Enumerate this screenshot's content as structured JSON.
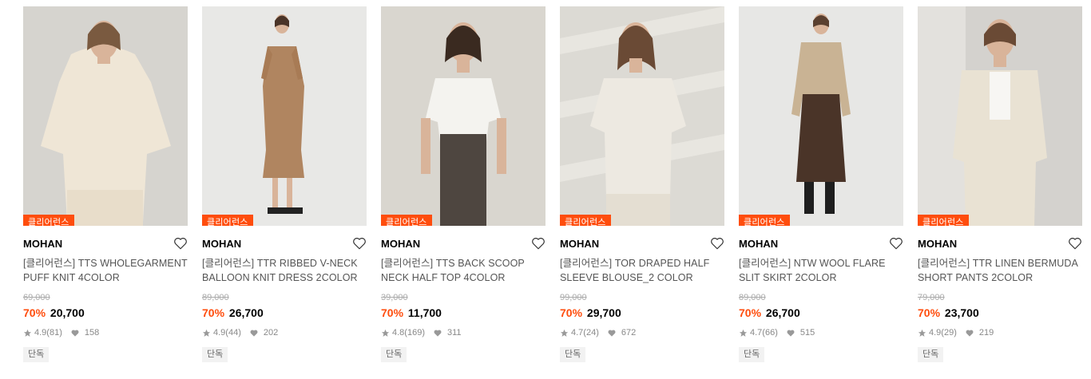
{
  "products": [
    {
      "badge": "클리어런스",
      "brand": "MOHAN",
      "name": "[클리어런스] TTS WHOLEGARMENT PUFF KNIT 4COLOR",
      "original_price": "69,000",
      "discount": "70%",
      "price": "20,700",
      "rating": "4.9",
      "reviews": "(81)",
      "likes": "158",
      "tag": "단독",
      "bg": "#cfcdc8",
      "garment": "#efe6d6"
    },
    {
      "badge": "클리어런스",
      "brand": "MOHAN",
      "name": "[클리어런스] TTR RIBBED V-NECK BALLOON KNIT DRESS 2COLOR",
      "original_price": "89,000",
      "discount": "70%",
      "price": "26,700",
      "rating": "4.9",
      "reviews": "(44)",
      "likes": "202",
      "tag": "단독",
      "bg": "#e8e8e6",
      "garment": "#b08560"
    },
    {
      "badge": "클리어런스",
      "brand": "MOHAN",
      "name": "[클리어런스] TTS BACK SCOOP NECK HALF TOP 4COLOR",
      "original_price": "39,000",
      "discount": "70%",
      "price": "11,700",
      "rating": "4.8",
      "reviews": "(169)",
      "likes": "311",
      "tag": "단독",
      "bg": "#d9d6cf",
      "garment": "#f4f3ef"
    },
    {
      "badge": "클리어런스",
      "brand": "MOHAN",
      "name": "[클리어런스] TOR DRAPED HALF SLEEVE BLOUSE_2 COLOR",
      "original_price": "99,000",
      "discount": "70%",
      "price": "29,700",
      "rating": "4.7",
      "reviews": "(24)",
      "likes": "672",
      "tag": "단독",
      "bg": "#dcdad4",
      "garment": "#ede9e1"
    },
    {
      "badge": "클리어런스",
      "brand": "MOHAN",
      "name": "[클리어런스] NTW WOOL FLARE SLIT SKIRT 2COLOR",
      "original_price": "89,000",
      "discount": "70%",
      "price": "26,700",
      "rating": "4.7",
      "reviews": "(66)",
      "likes": "515",
      "tag": "단독",
      "bg": "#e7e7e5",
      "garment": "#4a3428"
    },
    {
      "badge": "클리어런스",
      "brand": "MOHAN",
      "name": "[클리어런스] TTR LINEN BERMUDA SHORT PANTS 2COLOR",
      "original_price": "79,000",
      "discount": "70%",
      "price": "23,700",
      "rating": "4.9",
      "reviews": "(29)",
      "likes": "219",
      "tag": "단독",
      "bg": "#d4d2ce",
      "garment": "#e9e2d3"
    }
  ],
  "colors": {
    "accent": "#ff4d0d",
    "tag_bg": "#f2f2f2"
  },
  "icons": {
    "heart": "heart-outline-icon",
    "star": "star-icon",
    "like": "heart-filled-icon"
  }
}
